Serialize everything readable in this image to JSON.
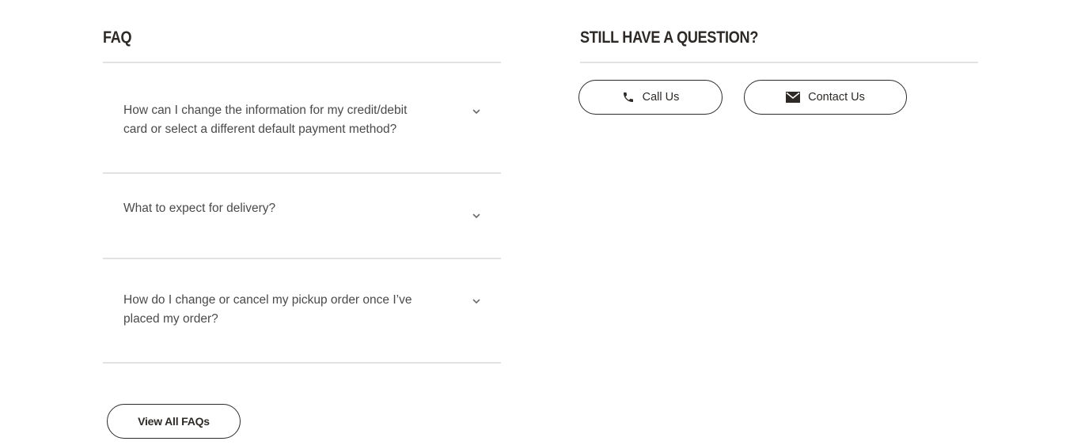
{
  "faq": {
    "title": "FAQ",
    "items": [
      {
        "question": "How can I change the information for my credit/debit card or select a different default payment method?"
      },
      {
        "question": "What to expect for delivery?"
      },
      {
        "question": "How do I change or cancel my pickup order once I’ve placed my order?"
      }
    ],
    "view_all_label": "View All FAQs"
  },
  "contact": {
    "title": "STILL HAVE A QUESTION?",
    "call_label": "Call Us",
    "call_icon": "phone-icon",
    "contact_label": "Contact Us",
    "contact_icon": "envelope-icon"
  },
  "colors": {
    "text": "#2d2926",
    "question_text": "#4a4a4a",
    "divider": "#e2e2e2",
    "background": "#ffffff"
  }
}
